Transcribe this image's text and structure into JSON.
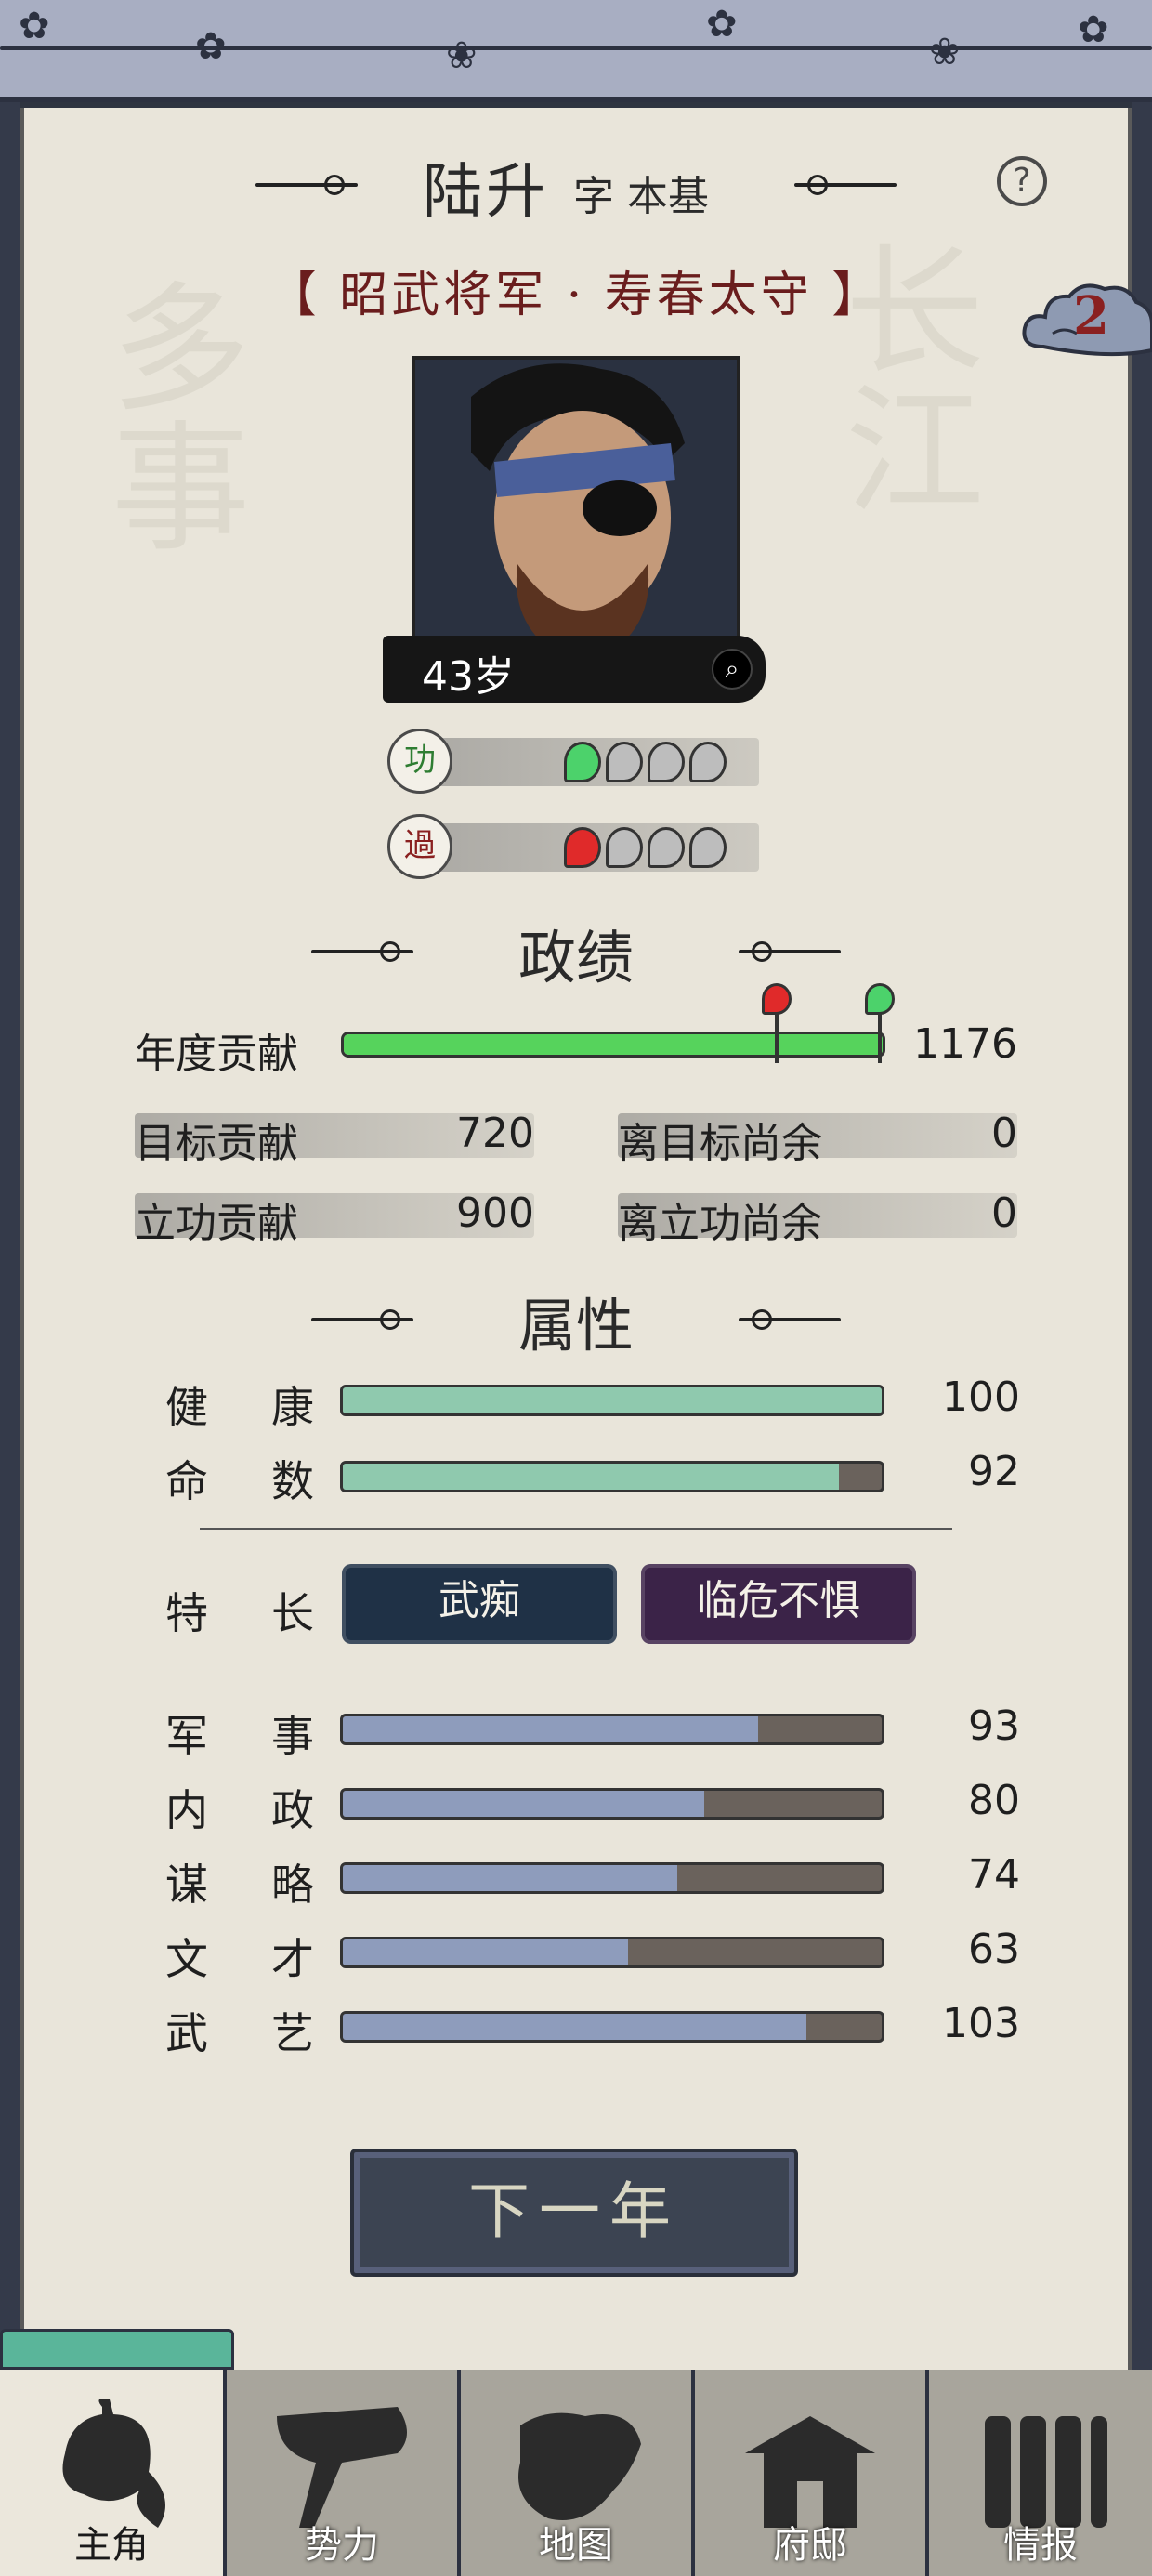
{
  "character": {
    "name": "陆升",
    "courtesy_name": "字 本基",
    "titles": "【 昭武将军 · 寿春太守 】",
    "age": "43岁",
    "notification_count": "2"
  },
  "merit": {
    "label": "功",
    "filled": 1,
    "total": 4,
    "color": "#4cd26b"
  },
  "demerit": {
    "label": "過",
    "filled": 1,
    "total": 4,
    "color": "#e02a2a"
  },
  "performance": {
    "section_title": "政绩",
    "annual_contribution": {
      "label": "年度贡献",
      "value": "1176",
      "fill_fraction": 1.0,
      "demerit_marker_fraction": 0.8,
      "merit_marker_fraction": 1.0
    },
    "stats": [
      {
        "label": "目标贡献",
        "value": "720"
      },
      {
        "label": "离目标尚余",
        "value": "0"
      },
      {
        "label": "立功贡献",
        "value": "900"
      },
      {
        "label": "离立功尚余",
        "value": "0"
      }
    ]
  },
  "attributes": {
    "section_title": "属性",
    "vitals": [
      {
        "label_a": "健",
        "label_b": "康",
        "value": "100",
        "fraction": 1.0
      },
      {
        "label_a": "命",
        "label_b": "数",
        "value": "92",
        "fraction": 0.92
      }
    ],
    "specialty": {
      "label_a": "特",
      "label_b": "长",
      "traits": [
        "武痴",
        "临危不惧"
      ]
    },
    "skills": [
      {
        "label_a": "军",
        "label_b": "事",
        "value": "93",
        "fraction": 0.77
      },
      {
        "label_a": "内",
        "label_b": "政",
        "value": "80",
        "fraction": 0.67
      },
      {
        "label_a": "谋",
        "label_b": "略",
        "value": "74",
        "fraction": 0.62
      },
      {
        "label_a": "文",
        "label_b": "才",
        "value": "63",
        "fraction": 0.53
      },
      {
        "label_a": "武",
        "label_b": "艺",
        "value": "103",
        "fraction": 0.86
      }
    ]
  },
  "actions": {
    "next_year": "下一年"
  },
  "nav": {
    "tabs": [
      {
        "label": "主角",
        "icon": "warrior-head-icon",
        "active": true
      },
      {
        "label": "势力",
        "icon": "war-flag-icon",
        "active": false
      },
      {
        "label": "地图",
        "icon": "map-icon",
        "active": false
      },
      {
        "label": "府邸",
        "icon": "mansion-icon",
        "active": false
      },
      {
        "label": "情报",
        "icon": "scroll-icon",
        "active": false
      }
    ]
  },
  "colors": {
    "contribution_bar": "#56d35c",
    "vital_bar": "#8fc9ae",
    "skill_bar": "#8e9cbc",
    "skill_track": "#6a625c",
    "trait_1_bg": "#1f3146",
    "trait_2_bg": "#3b2348",
    "title_red": "#6a1d1d"
  }
}
